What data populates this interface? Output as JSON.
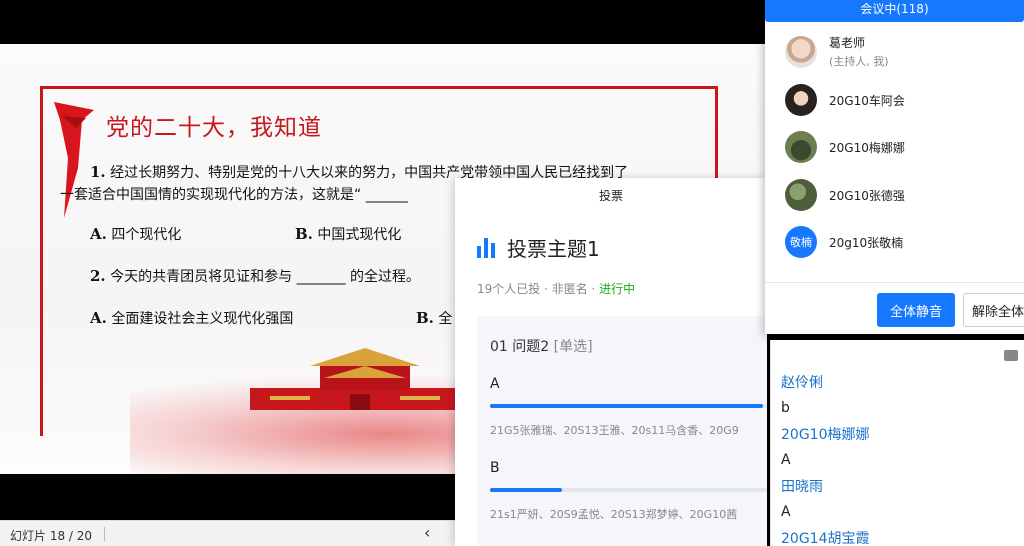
{
  "slide": {
    "title": "党的二十大，我知道",
    "q1_num": "1.",
    "q1_line1": "经过长期努力、特别是党的十八大以来的努力，中国共产党带领中国人民已经找到了",
    "q1_line2": "一套适合中国国情的实现现代化的方法，这就是“ ______",
    "q1_optA_letter": "A.",
    "q1_optA": "四个现代化",
    "q1_optB_letter": "B.",
    "q1_optB": "中国式现代化",
    "q2_num": "2.",
    "q2_text": "今天的共青团员将见证和参与 _______ 的全过程。",
    "q2_optA_letter": "A.",
    "q2_optA": "全面建设社会主义现代化强国",
    "q2_optB_letter": "B.",
    "q2_optB": "全"
  },
  "bottom_bar": {
    "slide_counter": "幻灯片 18 / 20"
  },
  "vote": {
    "header": "投票",
    "title": "投票主题1",
    "meta": "19个人已投 · 非匿名 · ",
    "status": "进行中",
    "question_title": "01 问题2",
    "question_type": "[单选]",
    "options": [
      {
        "label": "A",
        "fill": 0.95,
        "voters": "21G5张雅瑞、20S13王雅、20s11马含香、20G9"
      },
      {
        "label": "B",
        "fill": 0.25,
        "voters": "21s1严妍、20S9孟悦、20S13郑梦婷、20G10茜"
      }
    ]
  },
  "participants": {
    "header": "会议中(118)",
    "items": [
      {
        "name": "葛老师",
        "sub": "(主持人, 我)"
      },
      {
        "name": "20G10车阿会"
      },
      {
        "name": "20G10梅娜娜"
      },
      {
        "name": "20G10张德强"
      },
      {
        "name": "20g10张敬楠",
        "avatar_text": "敬楠"
      }
    ],
    "mute_all": "全体静音",
    "unmute_all": "解除全体"
  },
  "chat": {
    "lines": [
      {
        "text": "赵伶俐",
        "kind": "name"
      },
      {
        "text": "b",
        "kind": "msg"
      },
      {
        "text": "20G10梅娜娜",
        "kind": "name"
      },
      {
        "text": "A",
        "kind": "msg"
      },
      {
        "text": "田晓雨",
        "kind": "name"
      },
      {
        "text": "A",
        "kind": "msg"
      },
      {
        "text": "20G14胡宝霞",
        "kind": "name"
      }
    ]
  },
  "colors": {
    "accent": "#1677ff",
    "slide_red": "#c8161d",
    "status_green": "#1aad19"
  }
}
